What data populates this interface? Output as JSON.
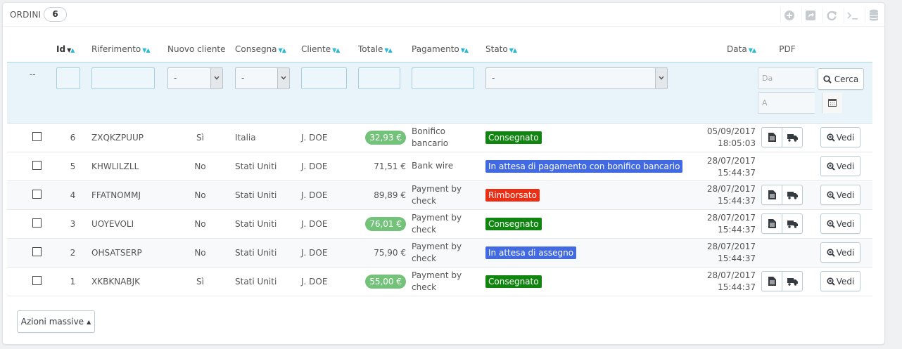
{
  "header": {
    "title": "ORDINI",
    "count": "6",
    "tools": [
      "add-icon",
      "export-icon",
      "refresh-icon",
      "sql-icon",
      "database-icon"
    ]
  },
  "columns": {
    "id": "Id",
    "reference": "Riferimento",
    "new_client": "Nuovo cliente",
    "delivery": "Consegna",
    "customer": "Cliente",
    "total": "Totale",
    "payment": "Pagamento",
    "status": "Stato",
    "date": "Data",
    "pdf": "PDF"
  },
  "filters": {
    "bulk_placeholder": "--",
    "new_client_value": "-",
    "delivery_value": "-",
    "status_value": "-",
    "date_from": "Da",
    "date_to": "A",
    "pdf_placeholder": "--",
    "search_label": "Cerca"
  },
  "rows": [
    {
      "id": "6",
      "reference": "ZXQKZPUUP",
      "new_client": "Sì",
      "delivery": "Italia",
      "customer": "J. DOE",
      "total": "32,93 €",
      "total_highlight": true,
      "payment": "Bonifico bancario",
      "status": "Consegnato",
      "status_color": "#108510",
      "date": "05/09/2017",
      "time": "18:05:03",
      "has_pdf": true,
      "view_label": "Vedi"
    },
    {
      "id": "5",
      "reference": "KHWLILZLL",
      "new_client": "No",
      "delivery": "Stati Uniti",
      "customer": "J. DOE",
      "total": "71,51 €",
      "total_highlight": false,
      "payment": "Bank wire",
      "status": "In attesa di pagamento con bonifico bancario",
      "status_color": "#4169e1",
      "date": "28/07/2017",
      "time": "15:44:37",
      "has_pdf": false,
      "view_label": "Vedi"
    },
    {
      "id": "4",
      "reference": "FFATNOMMJ",
      "new_client": "No",
      "delivery": "Stati Uniti",
      "customer": "J. DOE",
      "total": "89,89 €",
      "total_highlight": false,
      "payment": "Payment by check",
      "status": "Rimborsato",
      "status_color": "#ec2e15",
      "date": "28/07/2017",
      "time": "15:44:37",
      "has_pdf": true,
      "view_label": "Vedi"
    },
    {
      "id": "3",
      "reference": "UOYEVOLI",
      "new_client": "No",
      "delivery": "Stati Uniti",
      "customer": "J. DOE",
      "total": "76,01 €",
      "total_highlight": true,
      "payment": "Payment by check",
      "status": "Consegnato",
      "status_color": "#108510",
      "date": "28/07/2017",
      "time": "15:44:37",
      "has_pdf": true,
      "view_label": "Vedi"
    },
    {
      "id": "2",
      "reference": "OHSATSERP",
      "new_client": "No",
      "delivery": "Stati Uniti",
      "customer": "J. DOE",
      "total": "75,90 €",
      "total_highlight": false,
      "payment": "Payment by check",
      "status": "In attesa di assegno",
      "status_color": "#4169e1",
      "date": "28/07/2017",
      "time": "15:44:37",
      "has_pdf": false,
      "view_label": "Vedi"
    },
    {
      "id": "1",
      "reference": "XKBKNABJK",
      "new_client": "Sì",
      "delivery": "Stati Uniti",
      "customer": "J. DOE",
      "total": "55,00 €",
      "total_highlight": true,
      "payment": "Payment by check",
      "status": "Consegnato",
      "status_color": "#108510",
      "date": "28/07/2017",
      "time": "15:44:37",
      "has_pdf": true,
      "view_label": "Vedi"
    }
  ],
  "footer": {
    "bulk_actions_label": "Azioni massive"
  },
  "colors": {
    "accent": "#25b9d7",
    "filter_bg": "#e8f4fa",
    "highlight_total": "#72c279"
  }
}
